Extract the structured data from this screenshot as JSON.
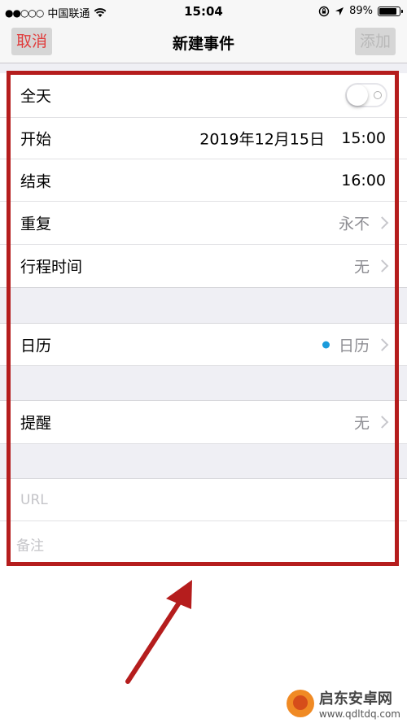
{
  "status_bar": {
    "signal": "●●○○○",
    "carrier": "中国联通",
    "time": "15:04",
    "battery_text": "89%",
    "battery_level": 0.89
  },
  "nav": {
    "cancel_label": "取消",
    "title": "新建事件",
    "add_label": "添加"
  },
  "form": {
    "all_day_label": "全天",
    "all_day_on": false,
    "start_label": "开始",
    "start_date": "2019年12月15日",
    "start_time": "15:00",
    "end_label": "结束",
    "end_time": "16:00",
    "repeat_label": "重复",
    "repeat_value": "永不",
    "travel_label": "行程时间",
    "travel_value": "无",
    "calendar_label": "日历",
    "calendar_value": "日历",
    "calendar_color": "#1a9bdb",
    "alert_label": "提醒",
    "alert_value": "无",
    "url_placeholder": "URL",
    "notes_placeholder": "备注"
  },
  "watermark": {
    "title": "启东安卓网",
    "url": "www.qdltdq.com"
  },
  "colors": {
    "accent_red": "#e03c3c",
    "annotation": "#b51d1d"
  }
}
